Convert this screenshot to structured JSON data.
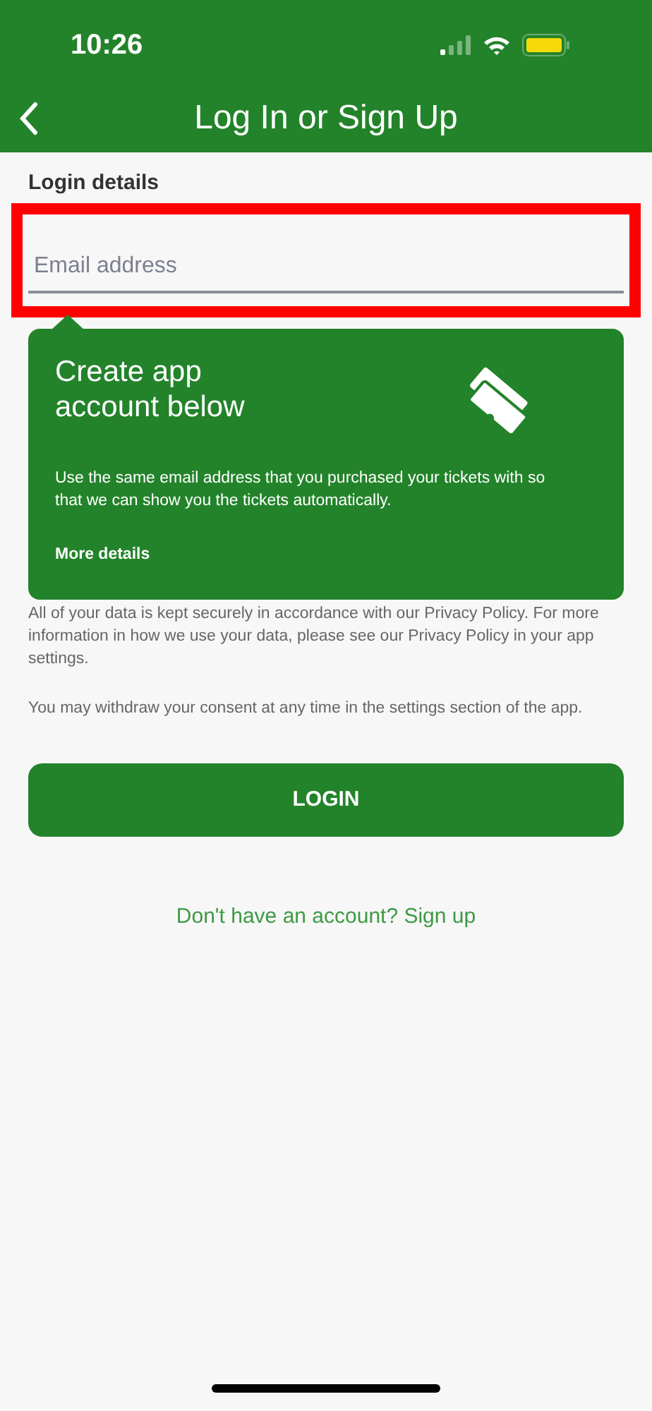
{
  "status_bar": {
    "time": "10:26"
  },
  "header": {
    "title": "Log In or Sign Up"
  },
  "section_label": "Login details",
  "email_field": {
    "placeholder": "Email address",
    "highlighted": true
  },
  "tooltip": {
    "title": "Create app account below",
    "body": "Use the same email address that you purchased your tickets with so that we can show you the tickets automatically.",
    "link": "More details"
  },
  "notes": [
    "All of your data is kept securely in accordance with our Privacy Policy. For more information in how we use your data, please see our Privacy Policy in your app settings.",
    "You may withdraw your consent at any time in the settings section of the app."
  ],
  "login_button": "LOGIN",
  "signup_link": "Don't have an account? Sign up"
}
